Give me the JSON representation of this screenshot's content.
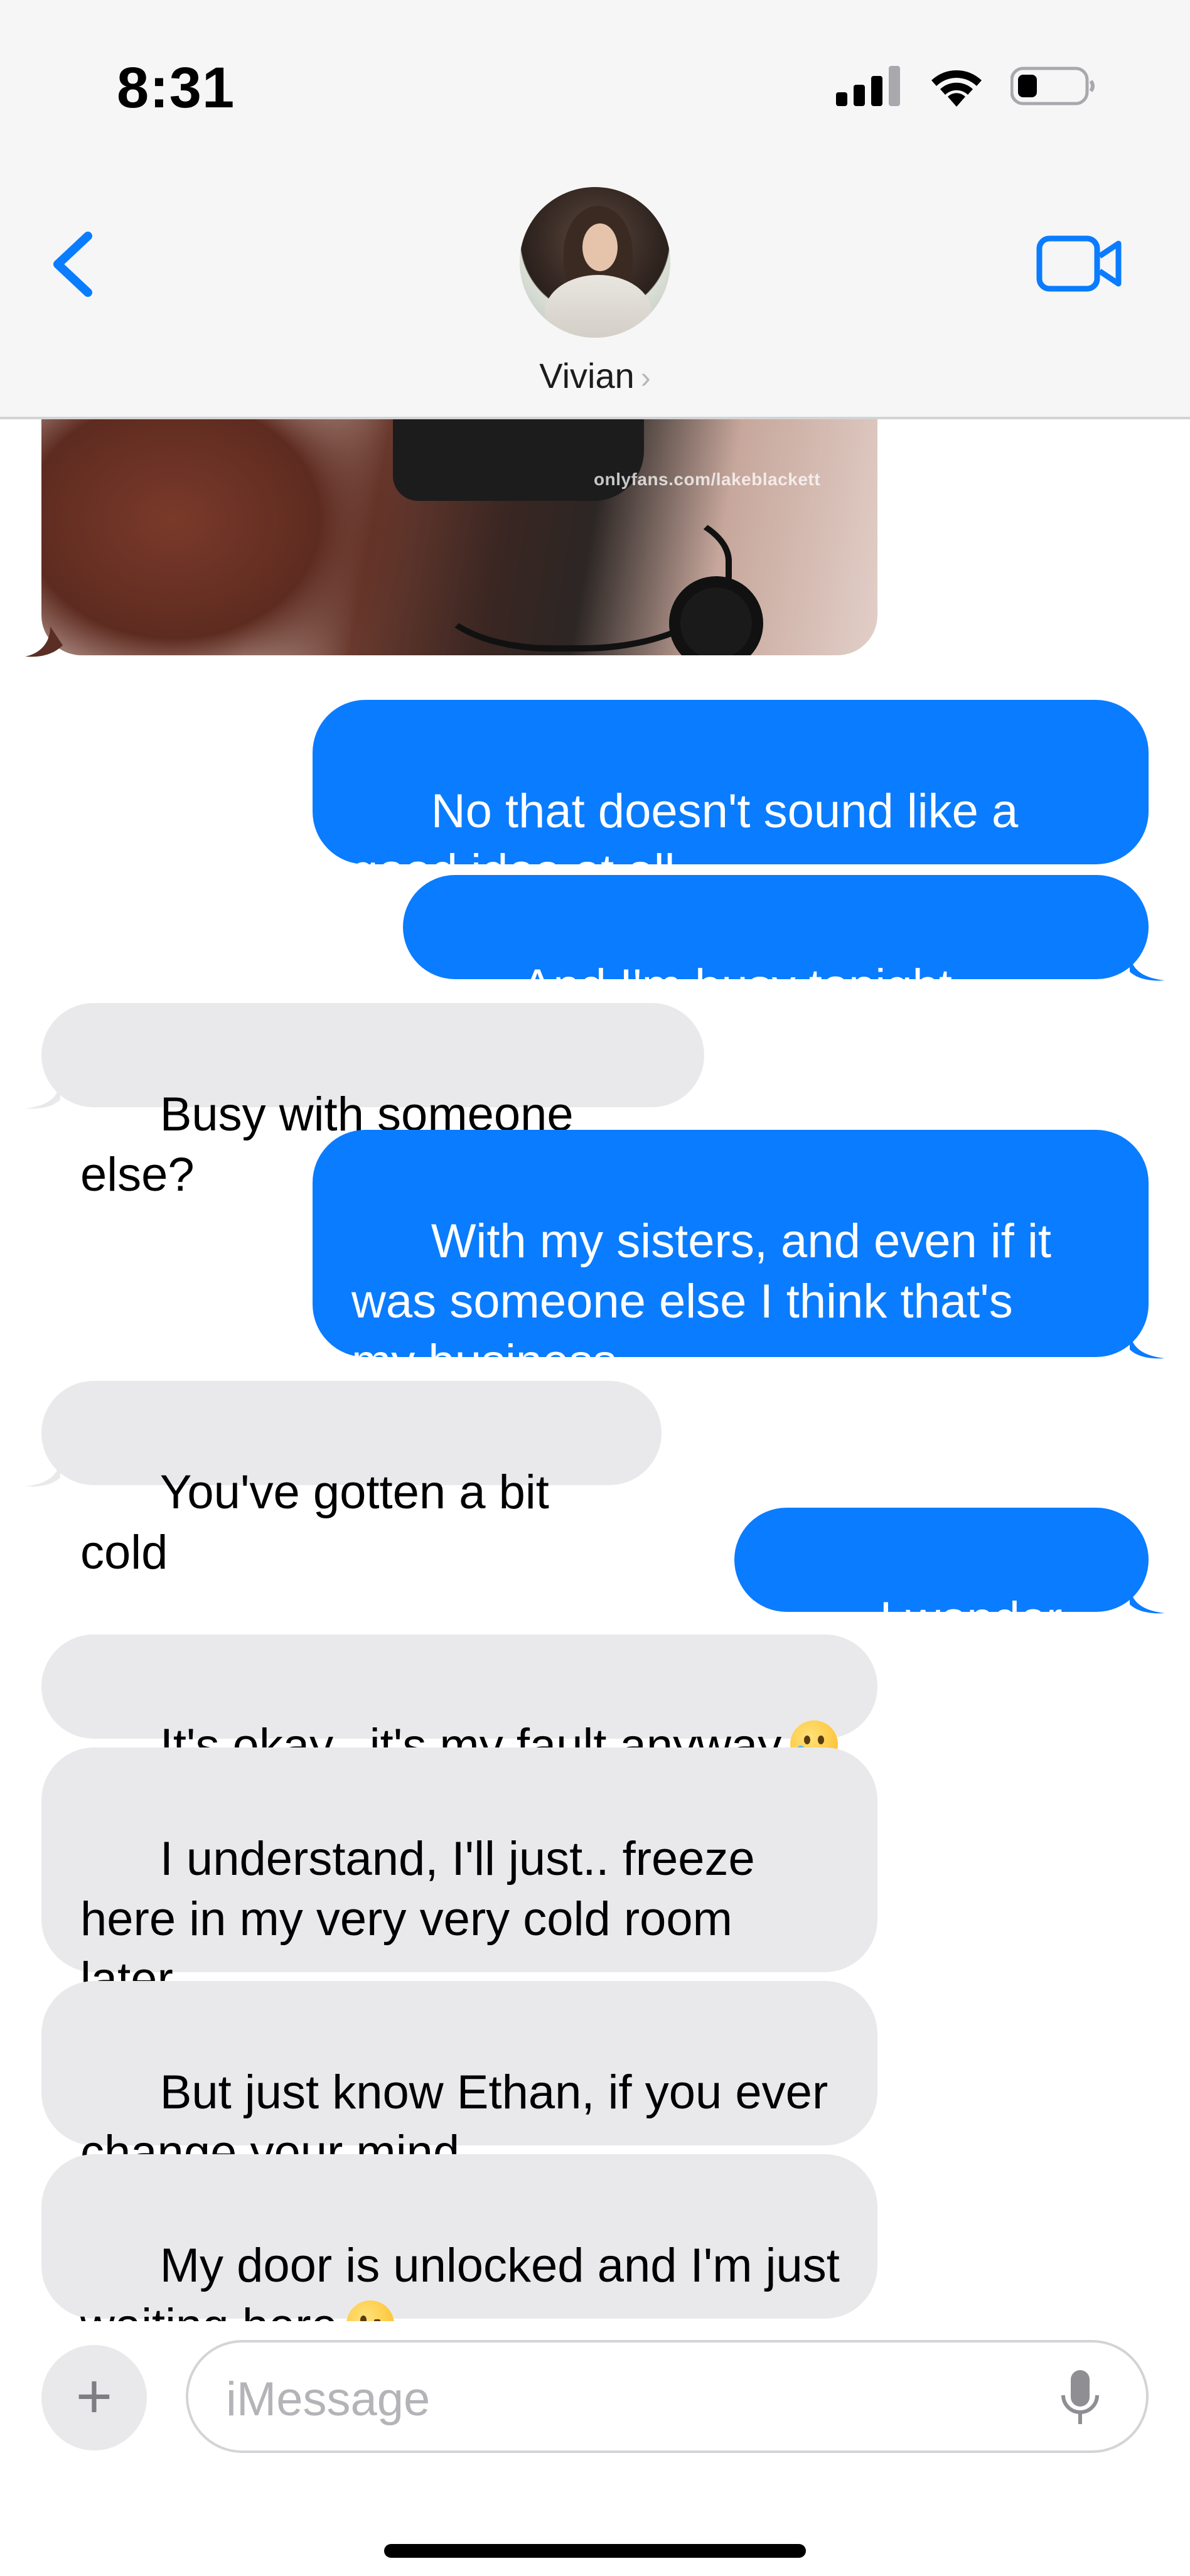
{
  "status_bar": {
    "time": "8:31",
    "icons": [
      "cellular-signal-icon",
      "wifi-icon",
      "battery-low-icon"
    ]
  },
  "header": {
    "contact_name": "Vivian",
    "chevron": "›",
    "icons": [
      "back-chevron-icon",
      "avatar",
      "video-call-icon"
    ],
    "accent_color": "#0a7cff"
  },
  "attachment": {
    "type": "photo",
    "watermark": "onlyfans.com/lakeblackett"
  },
  "messages": [
    {
      "direction": "outgoing",
      "text": "No that doesn't sound like a\ngood idea at all"
    },
    {
      "direction": "outgoing",
      "text": "And I'm busy tonight anyway"
    },
    {
      "direction": "incoming",
      "text": "Busy with someone else?"
    },
    {
      "direction": "outgoing",
      "text": "With my sisters, and even if it\nwas someone else I think that's\nmy business"
    },
    {
      "direction": "incoming",
      "text": "You've gotten a bit cold"
    },
    {
      "direction": "outgoing",
      "text": "..I wonder why"
    },
    {
      "direction": "incoming",
      "text": "It's okay.. it's my fault anyway",
      "emoji": "crying-face-emoji"
    },
    {
      "direction": "incoming",
      "text": "I understand, I'll just.. freeze\nhere in my very very cold room\nlater"
    },
    {
      "direction": "incoming",
      "text": "But just know Ethan, if you ever\nchange your mind"
    },
    {
      "direction": "incoming",
      "text": "My door is unlocked and I'm just\nwaiting here",
      "emoji": "winking-face-emoji"
    }
  ],
  "input_bar": {
    "plus_label": "+",
    "placeholder": "iMessage",
    "value": "",
    "icons": [
      "plus-icon",
      "microphone-icon"
    ]
  },
  "colors": {
    "outgoing_bubble": "#0a7cff",
    "incoming_bubble": "#e9e9eb",
    "header_bg": "#f6f6f6"
  }
}
